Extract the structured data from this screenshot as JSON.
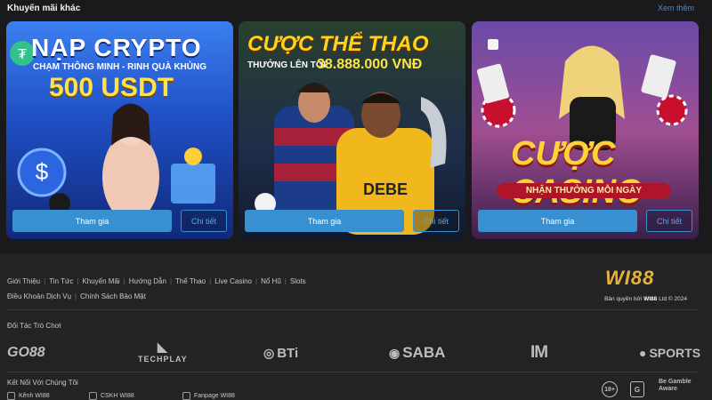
{
  "promos": {
    "header": "Khuyến mãi khác",
    "see_more": "Xem thêm",
    "cards": [
      {
        "title": "NẠP CRYPTO",
        "subtitle": "CHẠM THÔNG MINH - RINH QUÀ KHỦNG",
        "highlight": "500 USDT",
        "join_label": "Tham gia",
        "detail_label": "Chi tiết"
      },
      {
        "title": "CƯỢC THỂ THAO",
        "subtitle": "THƯỞNG LÊN TỚI",
        "highlight": "38.888.000 VNĐ",
        "join_label": "Tham gia",
        "detail_label": "Chi tiết"
      },
      {
        "title": "CƯỢC CASINO",
        "subtitle": "NHẬN THƯỞNG MỖI NGÀY",
        "join_label": "Tham gia",
        "detail_label": "Chi tiết"
      }
    ]
  },
  "footer": {
    "links_row1": [
      "Giới Thiệu",
      "Tin Tức",
      "Khuyến Mãi",
      "Hướng Dẫn",
      "Thể Thao",
      "Live Casino",
      "Nổ Hũ",
      "Slots"
    ],
    "links_row2": [
      "Điều Khoản Dịch Vụ",
      "Chính Sách Bảo Mật"
    ],
    "brand": "WI88",
    "copyright_prefix": "Bản quyền bởi",
    "copyright_brand": "WI88",
    "copyright_suffix": "Ltd © 2024",
    "partners_title": "Đối Tác Trò Chơi",
    "partners": [
      "GO88",
      "TECHPLAY",
      "BTi",
      "SABA",
      "IM",
      "SPORTS"
    ],
    "connect_title": "Kết Nối Với Chúng Tôi",
    "socials": [
      "Kênh WI88",
      "CSKH WI88",
      "Fanpage WI88"
    ],
    "badges": [
      "18+",
      "G",
      "Be Gamble Aware"
    ]
  },
  "colors": {
    "accent": "#3990d1",
    "link_blue": "#3b8fd6",
    "gold": "#e4b33a",
    "background": "#1b1b1d"
  }
}
